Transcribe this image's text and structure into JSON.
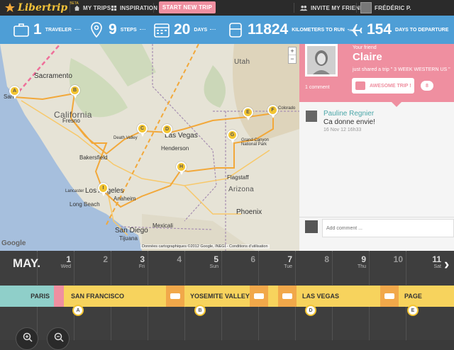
{
  "nav": {
    "logo": "Libertrip",
    "beta": "BETA",
    "my_trips": "MY TRIPS",
    "inspiration": "INSPIRATION",
    "start_trip": "START NEW TRIP",
    "invite": "INVITE MY FRIENDS",
    "user": "FRÉDÉRIC P."
  },
  "stats": {
    "travelers": {
      "value": "1",
      "label": "TRAVELER"
    },
    "steps": {
      "value": "9",
      "label": "STEPS"
    },
    "days": {
      "value": "20",
      "label": "DAYS"
    },
    "km": {
      "value": "11824",
      "label": "KILOMETERS TO RUN"
    },
    "departure": {
      "value": "154",
      "label": "DAYS TO DEPARTURE"
    }
  },
  "map": {
    "labels": {
      "utah": "Utah",
      "arizona": "Arizona",
      "california": "California",
      "sacramento": "Sacramento",
      "fresno": "Fresno",
      "bakersfield": "Bakersfield",
      "las_vegas": "Las Vegas",
      "henderson": "Henderson",
      "los_angeles": "Los Angeles",
      "long_beach": "Long Beach",
      "anaheim": "Anaheim",
      "san_diego": "San Diego",
      "tijuana": "Tijuana",
      "mexicali": "Mexicali",
      "phoenix": "Phoenix",
      "flagstaff": "Flagstaff",
      "grand_canyon": "Grand Canyon National Park",
      "death_valley": "Death Valley",
      "lancaster": "Lancaster",
      "san": "San",
      "colorado": "Colorado"
    },
    "zoom_in": "+",
    "zoom_out": "−",
    "google": "Google",
    "copyright": "Données cartographiques ©2012 Google, INEGI - Conditions d'utilisation",
    "pins": [
      "A",
      "B",
      "C",
      "D",
      "E",
      "F",
      "G",
      "H",
      "I"
    ]
  },
  "panel": {
    "your_friend": "Your friend",
    "friend_name": "Claire",
    "shared_text": "just shared a trip \" 3 WEEK WESTERN US \"",
    "comments_count": "1 comment",
    "awesome_label": "AWESOME TRIP !",
    "awesome_count": "8",
    "comment": {
      "author": "Pauline Regnier",
      "text": "Ca donne envie!",
      "time": "16 Nov 12 16h33"
    },
    "add_comment_placeholder": "Add comment ..."
  },
  "timeline": {
    "month": "MAY.",
    "days": [
      {
        "num": "1",
        "wd": "Wed"
      },
      {
        "num": "2",
        "wd": ""
      },
      {
        "num": "3",
        "wd": "Fri"
      },
      {
        "num": "4",
        "wd": ""
      },
      {
        "num": "5",
        "wd": "Sun"
      },
      {
        "num": "6",
        "wd": ""
      },
      {
        "num": "7",
        "wd": "Tue"
      },
      {
        "num": "8",
        "wd": ""
      },
      {
        "num": "9",
        "wd": "Thu"
      },
      {
        "num": "10",
        "wd": ""
      },
      {
        "num": "11",
        "wd": "Sat"
      }
    ],
    "segments": {
      "paris": "PARIS",
      "san_francisco": "SAN FRANCISCO",
      "yosemite": "YOSEMITE VALLEY",
      "las_vegas": "LAS VEGAS",
      "page": "PAGE"
    },
    "badges": {
      "a": "A",
      "b": "B",
      "d": "D",
      "e": "E"
    },
    "next": "›"
  },
  "colors": {
    "nav_bg": "#2b2b2b",
    "stats_bg": "#4e9ed6",
    "accent_pink": "#ef8fa0",
    "pin_yellow": "#f3c531",
    "city_yellow": "#f7d35d",
    "car_orange": "#f1a84a",
    "paris_teal": "#8fcfc9"
  }
}
